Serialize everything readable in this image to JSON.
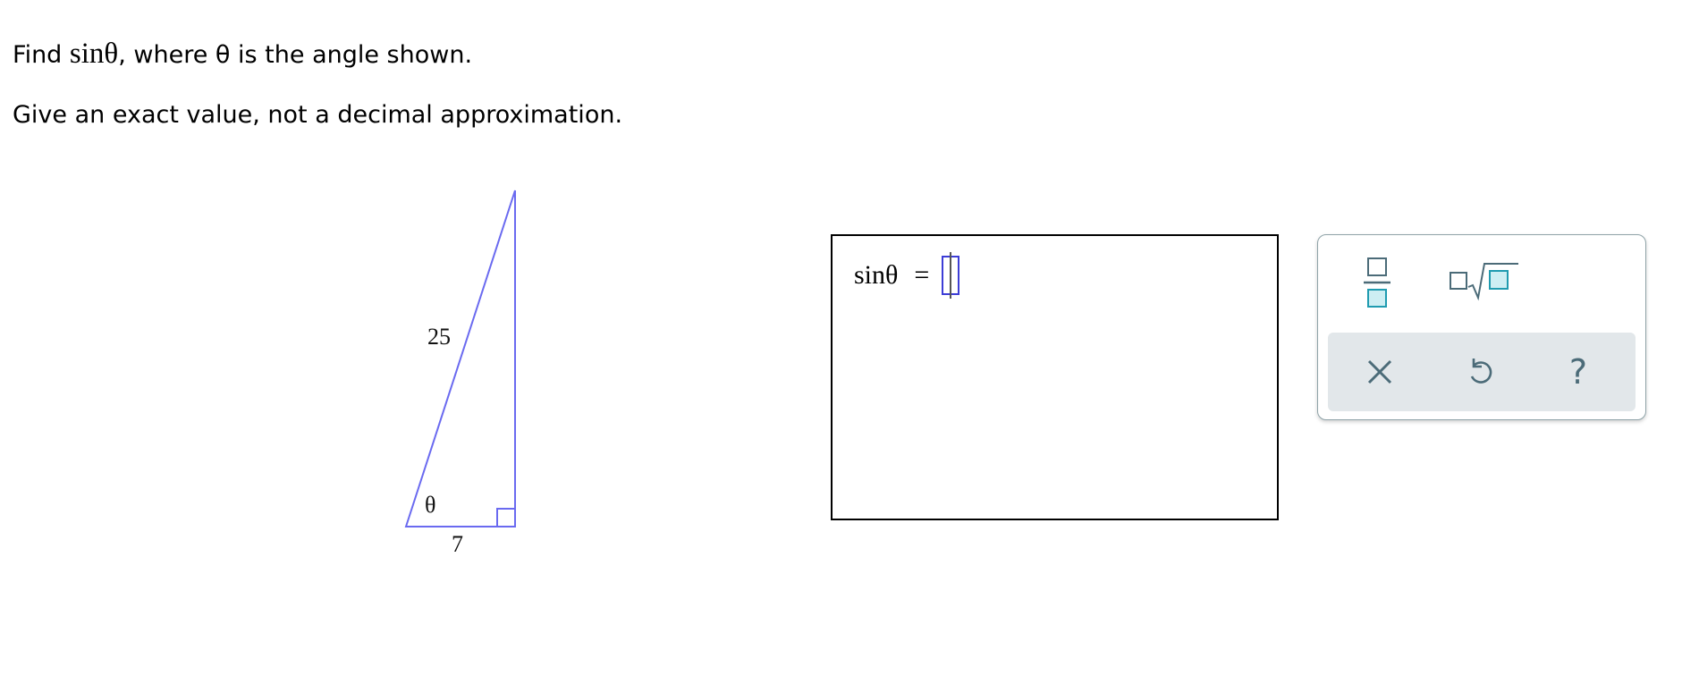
{
  "question": {
    "find_word": "Find",
    "func": "sinθ",
    "rest": ", where θ is the angle shown.",
    "instruction": "Give an exact value, not a decimal approximation."
  },
  "triangle": {
    "hypotenuse": "25",
    "adjacent": "7",
    "angle": "θ",
    "stroke_color": "#6a6af0"
  },
  "answer": {
    "lhs": "sinθ",
    "equals": "=",
    "value": ""
  },
  "keypad": {
    "buttons": [
      "fraction-icon",
      "nth-root-icon"
    ],
    "tools": [
      "clear-icon",
      "undo-icon",
      "help-icon"
    ],
    "help_symbol": "?",
    "accent_color": "#1f9bb0",
    "icon_color": "#4b6b78"
  }
}
